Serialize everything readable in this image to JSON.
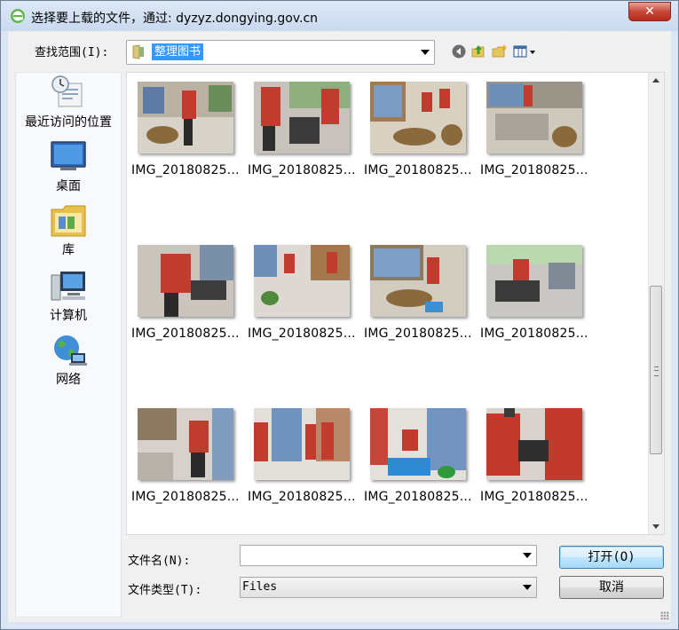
{
  "window": {
    "title": "选择要上载的文件，通过: dyzyz.dongying.gov.cn",
    "close_label": "✕"
  },
  "look_in": {
    "label": "查找范围(I):",
    "value": "整理图书"
  },
  "toolbar": {
    "icons": [
      "back-icon",
      "up-folder-icon",
      "new-folder-icon",
      "view-menu-icon"
    ]
  },
  "places": [
    {
      "label": "最近访问的位置",
      "icon": "recent-places-icon"
    },
    {
      "label": "桌面",
      "icon": "desktop-icon"
    },
    {
      "label": "库",
      "icon": "libraries-icon"
    },
    {
      "label": "计算机",
      "icon": "computer-icon"
    },
    {
      "label": "网络",
      "icon": "network-icon"
    }
  ],
  "files": [
    {
      "name": "IMG_20180825..."
    },
    {
      "name": "IMG_20180825..."
    },
    {
      "name": "IMG_20180825..."
    },
    {
      "name": "IMG_20180825..."
    },
    {
      "name": "IMG_20180825..."
    },
    {
      "name": "IMG_20180825..."
    },
    {
      "name": "IMG_20180825..."
    },
    {
      "name": "IMG_20180825..."
    },
    {
      "name": "IMG_20180825..."
    },
    {
      "name": "IMG_20180825..."
    },
    {
      "name": "IMG_20180825..."
    },
    {
      "name": "IMG_20180825..."
    }
  ],
  "filename": {
    "label": "文件名(N):",
    "value": ""
  },
  "filetype": {
    "label": "文件类型(T):",
    "value": "Files"
  },
  "buttons": {
    "open": "打开(O)",
    "cancel": "取消"
  },
  "colors": {
    "selection": "#3399ff",
    "window_frame": "#dbe6f4",
    "close_button": "#c7493a"
  }
}
